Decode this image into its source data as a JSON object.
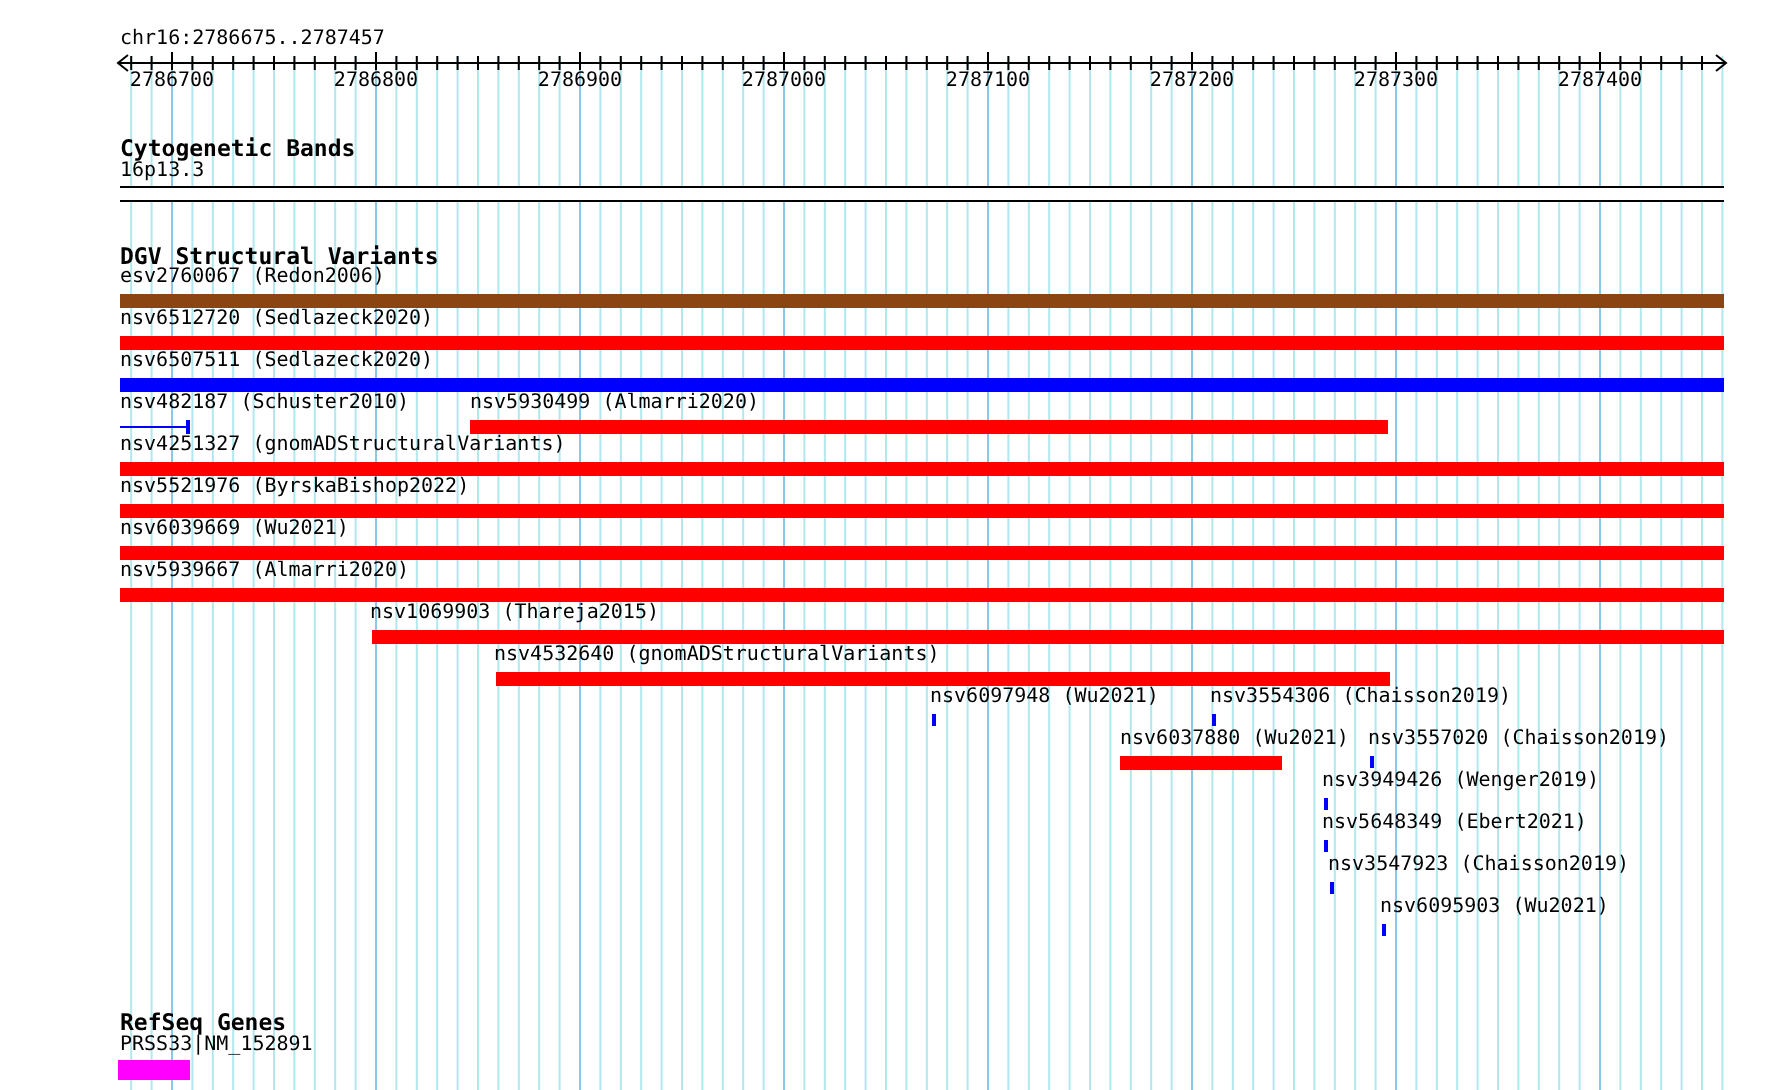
{
  "position": "chr16:2786675..2787457",
  "ruler": {
    "labels": [
      "2786700",
      "2786800",
      "2786900",
      "2787000",
      "2787100",
      "2787200",
      "2787300",
      "2787400"
    ]
  },
  "tracks": [
    {
      "title": "Cytogenetic Bands",
      "kind": "bands",
      "items": [
        {
          "label": "16p13.3"
        }
      ]
    },
    {
      "title": "DGV Structural Variants",
      "kind": "variants",
      "items": [
        {
          "label": "esv2760067 (Redon2006)",
          "color": "#8b4513",
          "kind": "bar"
        },
        {
          "label": "nsv6512720 (Sedlazeck2020)",
          "color": "#ff0000",
          "kind": "bar"
        },
        {
          "label": "nsv6507511 (Sedlazeck2020)",
          "color": "#0000ff",
          "kind": "bar"
        },
        {
          "label": "nsv482187 (Schuster2010)",
          "color": "#0000ff",
          "kind": "line"
        },
        {
          "label": "nsv5930499 (Almarri2020)",
          "color": "#ff0000",
          "kind": "bar"
        },
        {
          "label": "nsv4251327 (gnomADStructuralVariants)",
          "color": "#ff0000",
          "kind": "bar"
        },
        {
          "label": "nsv5521976 (ByrskaBishop2022)",
          "color": "#ff0000",
          "kind": "bar"
        },
        {
          "label": "nsv6039669 (Wu2021)",
          "color": "#ff0000",
          "kind": "bar"
        },
        {
          "label": "nsv5939667 (Almarri2020)",
          "color": "#ff0000",
          "kind": "bar"
        },
        {
          "label": "nsv1069903 (Thareja2015)",
          "color": "#ff0000",
          "kind": "bar"
        },
        {
          "label": "nsv4532640 (gnomADStructuralVariants)",
          "color": "#ff0000",
          "kind": "bar"
        },
        {
          "label": "nsv6097948 (Wu2021)",
          "color": "#0000ff",
          "kind": "bar"
        },
        {
          "label": "nsv3554306 (Chaisson2019)",
          "color": "#0000ff",
          "kind": "bar"
        },
        {
          "label": "nsv6037880 (Wu2021)",
          "color": "#ff0000",
          "kind": "bar"
        },
        {
          "label": "nsv3557020 (Chaisson2019)",
          "color": "#0000ff",
          "kind": "bar"
        },
        {
          "label": "nsv3949426 (Wenger2019)",
          "color": "#0000ff",
          "kind": "bar"
        },
        {
          "label": "nsv5648349 (Ebert2021)",
          "color": "#0000ff",
          "kind": "bar"
        },
        {
          "label": "nsv3547923 (Chaisson2019)",
          "color": "#0000ff",
          "kind": "bar"
        },
        {
          "label": "nsv6095903 (Wu2021)",
          "color": "#0000ff",
          "kind": "bar"
        }
      ]
    },
    {
      "title": "RefSeq Genes",
      "kind": "genes",
      "items": [
        {
          "label": "PRSS33|NM_152891",
          "color": "#ff00ff"
        }
      ]
    }
  ]
}
